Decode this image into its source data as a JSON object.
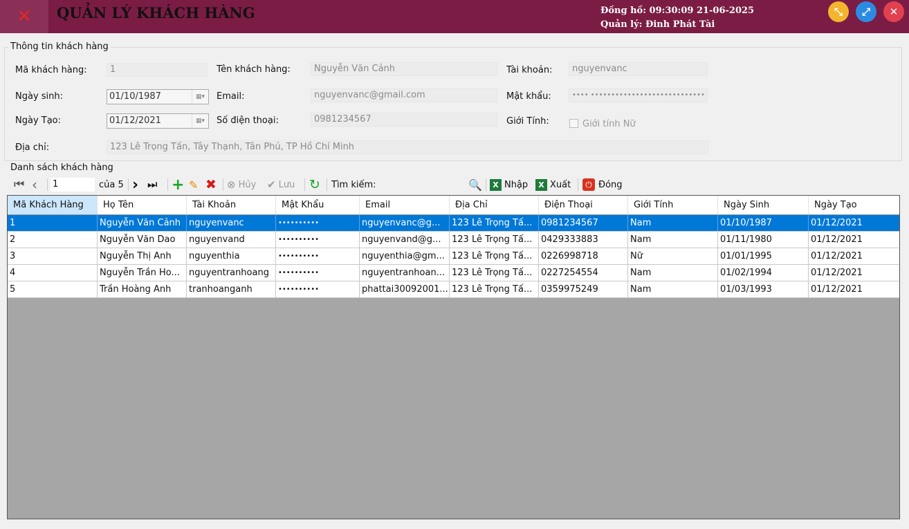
{
  "window": {
    "title": "QUẢN LÝ KHÁCH HÀNG",
    "clock_label": "Đồng hồ: 09:30:09 21-06-2025",
    "manager_label": "Quản lý: Đinh Phát Tài",
    "colors": {
      "titlebar": "#7b1c45",
      "selection": "#0078d7"
    }
  },
  "info": {
    "group_title": "Thông tin khách hàng",
    "labels": {
      "id": "Mã khách hàng:",
      "name": "Tên khách hàng:",
      "account": "Tài khoản:",
      "birthday": "Ngày sinh:",
      "email": "Email:",
      "password": "Mật khẩu:",
      "created": "Ngày Tạo:",
      "phone": "Số điện thoại:",
      "gender": "Giới Tính:",
      "address": "Địa chỉ:"
    },
    "values": {
      "id": "1",
      "name": "Nguyễn Văn Cảnh",
      "account": "nguyenvanc",
      "birthday": "01/10/1987",
      "email": "nguyenvanc@gmail.com",
      "password": "•••• ••••••••••••••••••••••••••••",
      "created": "01/12/2021",
      "phone": "0981234567",
      "gender_checkbox": "Giới tính Nữ",
      "address": "123 Lê Trọng Tấn, Tây Thạnh, Tân Phú, TP Hồ Chí Minh"
    }
  },
  "list": {
    "group_title": "Danh sách khách hàng",
    "toolbar": {
      "position": "1",
      "count": "của 5",
      "cancel": "Hủy",
      "save": "Lưu",
      "search": "Tìm kiếm:",
      "import": "Nhập",
      "export": "Xuất",
      "close": "Đóng"
    },
    "columns": [
      "Mã Khách Hàng",
      "Họ Tên",
      "Tài Khoản",
      "Mật Khẩu",
      "Email",
      "Địa Chỉ",
      "Điện Thoại",
      "Giới Tính",
      "Ngày Sinh",
      "Ngày Tạo"
    ],
    "rows": [
      [
        "1",
        "Nguyễn Văn Cảnh",
        "nguyenvanc",
        "••••••••••",
        "nguyenvanc@g...",
        "123 Lê Trọng Tấ...",
        "0981234567",
        "Nam",
        "01/10/1987",
        "01/12/2021"
      ],
      [
        "2",
        "Nguyễn Văn Dao",
        "nguyenvand",
        "••••••••••",
        "nguyenvand@g...",
        "123 Lê Trọng Tấ...",
        "0429333883",
        "Nam",
        "01/11/1980",
        "01/12/2021"
      ],
      [
        "3",
        "Nguyễn Thị Anh",
        "nguyenthia",
        "••••••••••",
        "nguyenthia@gm...",
        "123 Lê Trọng Tấ...",
        "0226998718",
        "Nữ",
        "01/01/1995",
        "01/12/2021"
      ],
      [
        "4",
        "Nguyễn Trần Ho...",
        "nguyentranhoang",
        "••••••••••",
        "nguyentranhoan...",
        "123 Lê Trọng Tấ...",
        "0227254554",
        "Nam",
        "01/02/1994",
        "01/12/2021"
      ],
      [
        "5",
        "Trần Hoàng Anh",
        "tranhoanganh",
        "••••••••••",
        "phattai30092001...",
        "123 Lê Trọng Tấ...",
        "0359975249",
        "Nam",
        "01/03/1993",
        "01/12/2021"
      ]
    ]
  }
}
